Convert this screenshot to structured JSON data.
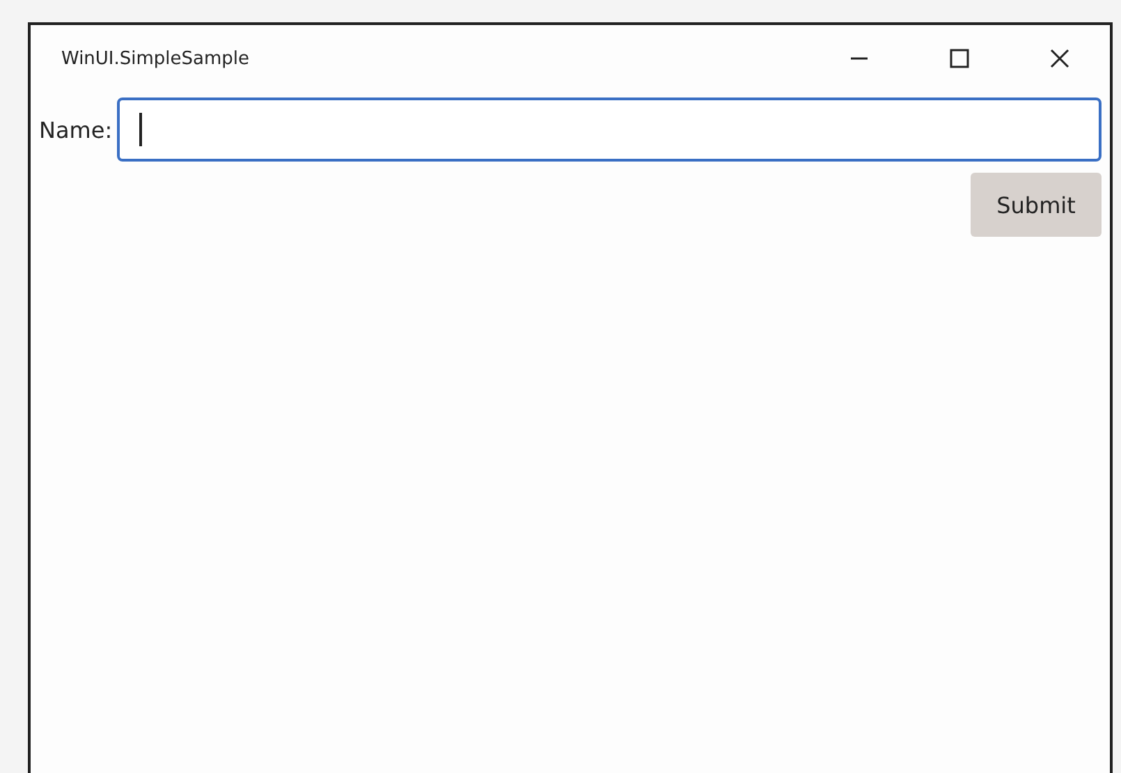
{
  "window": {
    "title": "WinUI.SimpleSample"
  },
  "form": {
    "label": "Name:",
    "field": {
      "focused": true
    },
    "button": "Submit"
  }
}
